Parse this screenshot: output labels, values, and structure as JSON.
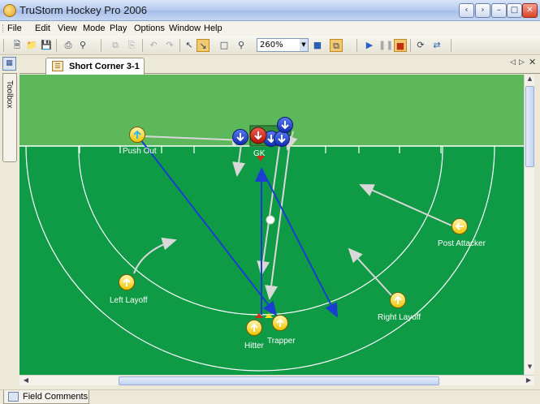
{
  "app": {
    "title": "TruStorm Hockey Pro 2006"
  },
  "menu": [
    "File",
    "Edit",
    "View",
    "Mode",
    "Play",
    "Options",
    "Window",
    "Help"
  ],
  "toolbar": {
    "zoom_value": "260%"
  },
  "sidebar": {
    "toolbox_label": "Toolbox"
  },
  "tab": {
    "label": "Short Corner 3-1"
  },
  "status": {
    "field_comments_label": "Field Comments"
  },
  "field": {
    "colors": {
      "outside": "#5cb85a",
      "inside": "#0f9a45",
      "line": "#ffffff",
      "blue_arrow": "#1a3fd0",
      "gray_arrow": "#d8d8d8"
    },
    "players": {
      "push_out": "Push Out",
      "goalkeeper": "GK",
      "post_attacker": "Post Attacker",
      "left_layoff": "Left Layoff",
      "right_layoff": "Right Layoff",
      "hitter": "Hitter",
      "trapper": "Trapper"
    }
  }
}
